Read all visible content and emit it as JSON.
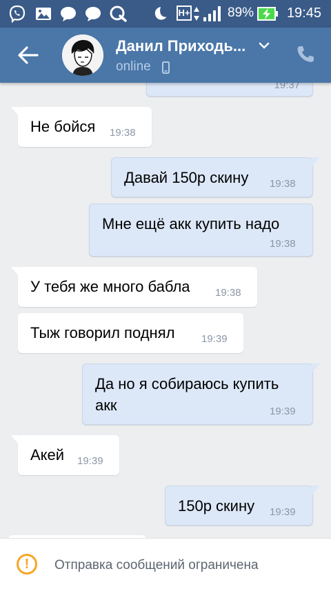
{
  "status_bar": {
    "battery_percent": "89%",
    "time": "19:45",
    "network_type": "H+",
    "icons": [
      "viber-icon",
      "gallery-icon",
      "chat-icon",
      "chat-icon",
      "q-icon",
      "moon-icon",
      "network-h-plus-icon",
      "signal-icon",
      "battery-charging-icon"
    ]
  },
  "header": {
    "contact_name": "Данил Приходь...",
    "status": "online",
    "icons": [
      "back-arrow-icon",
      "chevron-down-icon",
      "mobile-phone-icon",
      "call-icon"
    ]
  },
  "messages": [
    {
      "direction": "out",
      "text": "",
      "time": "19:37"
    },
    {
      "direction": "in",
      "text": "Не бойся",
      "time": "19:38"
    },
    {
      "direction": "out",
      "text": "Давай 150р скину",
      "time": "19:38"
    },
    {
      "direction": "out",
      "text": "Мне ещё акк купить надо",
      "time": "19:38"
    },
    {
      "direction": "in",
      "text": "У тебя же много бабла",
      "time": "19:38"
    },
    {
      "direction": "in",
      "text": "Тыж говорил поднял",
      "time": "19:39"
    },
    {
      "direction": "out",
      "text": "Да но я собираюсь купить",
      "text_line2": "акк",
      "time": "19:39"
    },
    {
      "direction": "in",
      "text": "Акей",
      "time": "19:39"
    },
    {
      "direction": "out",
      "text": "150р скину",
      "time": "19:39"
    }
  ],
  "bottom_bar": {
    "text": "Отправка сообщений ограничена",
    "icon": "warning-icon"
  },
  "colors": {
    "header": "#4a76a8",
    "status_bar": "#3a5b88",
    "incoming_bubble": "#ffffff",
    "outgoing_bubble": "#dce8f8",
    "background": "#edeef0",
    "warning": "#f5a623"
  }
}
